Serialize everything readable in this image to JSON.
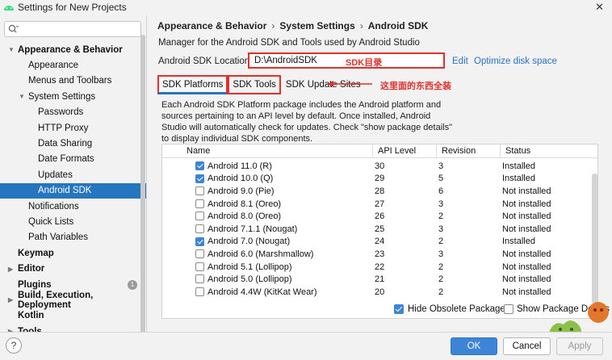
{
  "window": {
    "title": "Settings for New Projects"
  },
  "sidebar": {
    "search_placeholder": "",
    "items": [
      {
        "label": "Appearance & Behavior",
        "level": 0,
        "bold": true,
        "expanded": true
      },
      {
        "label": "Appearance",
        "level": 1
      },
      {
        "label": "Menus and Toolbars",
        "level": 1
      },
      {
        "label": "System Settings",
        "level": 1,
        "expanded": true
      },
      {
        "label": "Passwords",
        "level": 2
      },
      {
        "label": "HTTP Proxy",
        "level": 2
      },
      {
        "label": "Data Sharing",
        "level": 2
      },
      {
        "label": "Date Formats",
        "level": 2
      },
      {
        "label": "Updates",
        "level": 2
      },
      {
        "label": "Android SDK",
        "level": 2,
        "selected": true
      },
      {
        "label": "Notifications",
        "level": 1
      },
      {
        "label": "Quick Lists",
        "level": 1
      },
      {
        "label": "Path Variables",
        "level": 1
      },
      {
        "label": "Keymap",
        "level": 0,
        "bold": true
      },
      {
        "label": "Editor",
        "level": 0,
        "bold": true,
        "collapsed": true
      },
      {
        "label": "Plugins",
        "level": 0,
        "bold": true,
        "badge": "1"
      },
      {
        "label": "Build, Execution, Deployment",
        "level": 0,
        "bold": true,
        "collapsed": true
      },
      {
        "label": "Kotlin",
        "level": 0,
        "bold": true
      },
      {
        "label": "Tools",
        "level": 0,
        "bold": true,
        "collapsed": true
      }
    ]
  },
  "breadcrumb": [
    "Appearance & Behavior",
    "System Settings",
    "Android SDK"
  ],
  "breadcrumb_sep": "›",
  "description": "Manager for the Android SDK and Tools used by Android Studio",
  "sdk_location": {
    "label": "Android SDK Location:",
    "value": "D:\\AndroidSDK",
    "annotation": "SDK目录",
    "edit_link": "Edit",
    "optimize_link": "Optimize disk space"
  },
  "tabs": [
    {
      "label": "SDK Platforms",
      "active": true
    },
    {
      "label": "SDK Tools"
    },
    {
      "label": "SDK Update Sites"
    }
  ],
  "tab_annotation": "这里面的东西全装",
  "panel_description": "Each Android SDK Platform package includes the Android platform and sources pertaining to an API level by default. Once installed, Android Studio will automatically check for updates. Check \"show package details\" to display individual SDK components.",
  "table": {
    "columns": [
      "Name",
      "API Level",
      "Revision",
      "Status"
    ],
    "rows": [
      {
        "checked": true,
        "name": "Android 11.0 (R)",
        "api": "30",
        "revision": "3",
        "status": "Installed"
      },
      {
        "checked": true,
        "name": "Android 10.0 (Q)",
        "api": "29",
        "revision": "5",
        "status": "Installed"
      },
      {
        "checked": false,
        "name": "Android 9.0 (Pie)",
        "api": "28",
        "revision": "6",
        "status": "Not installed"
      },
      {
        "checked": false,
        "name": "Android 8.1 (Oreo)",
        "api": "27",
        "revision": "3",
        "status": "Not installed"
      },
      {
        "checked": false,
        "name": "Android 8.0 (Oreo)",
        "api": "26",
        "revision": "2",
        "status": "Not installed"
      },
      {
        "checked": false,
        "name": "Android 7.1.1 (Nougat)",
        "api": "25",
        "revision": "3",
        "status": "Not installed"
      },
      {
        "checked": true,
        "name": "Android 7.0 (Nougat)",
        "api": "24",
        "revision": "2",
        "status": "Installed"
      },
      {
        "checked": false,
        "name": "Android 6.0 (Marshmallow)",
        "api": "23",
        "revision": "3",
        "status": "Not installed"
      },
      {
        "checked": false,
        "name": "Android 5.1 (Lollipop)",
        "api": "22",
        "revision": "2",
        "status": "Not installed"
      },
      {
        "checked": false,
        "name": "Android 5.0 (Lollipop)",
        "api": "21",
        "revision": "2",
        "status": "Not installed"
      },
      {
        "checked": false,
        "name": "Android 4.4W (KitKat Wear)",
        "api": "20",
        "revision": "2",
        "status": "Not installed"
      }
    ]
  },
  "options": {
    "hide_obsolete": {
      "label": "Hide Obsolete Packages",
      "checked": true
    },
    "show_details": {
      "label": "Show Package Details",
      "checked": false
    }
  },
  "footer": {
    "help": "?",
    "ok": "OK",
    "cancel": "Cancel",
    "apply": "Apply"
  },
  "colors": {
    "accent": "#3d84d6",
    "selection": "#2675bf",
    "annotation_red": "#e0302b",
    "link": "#2a72c4"
  }
}
